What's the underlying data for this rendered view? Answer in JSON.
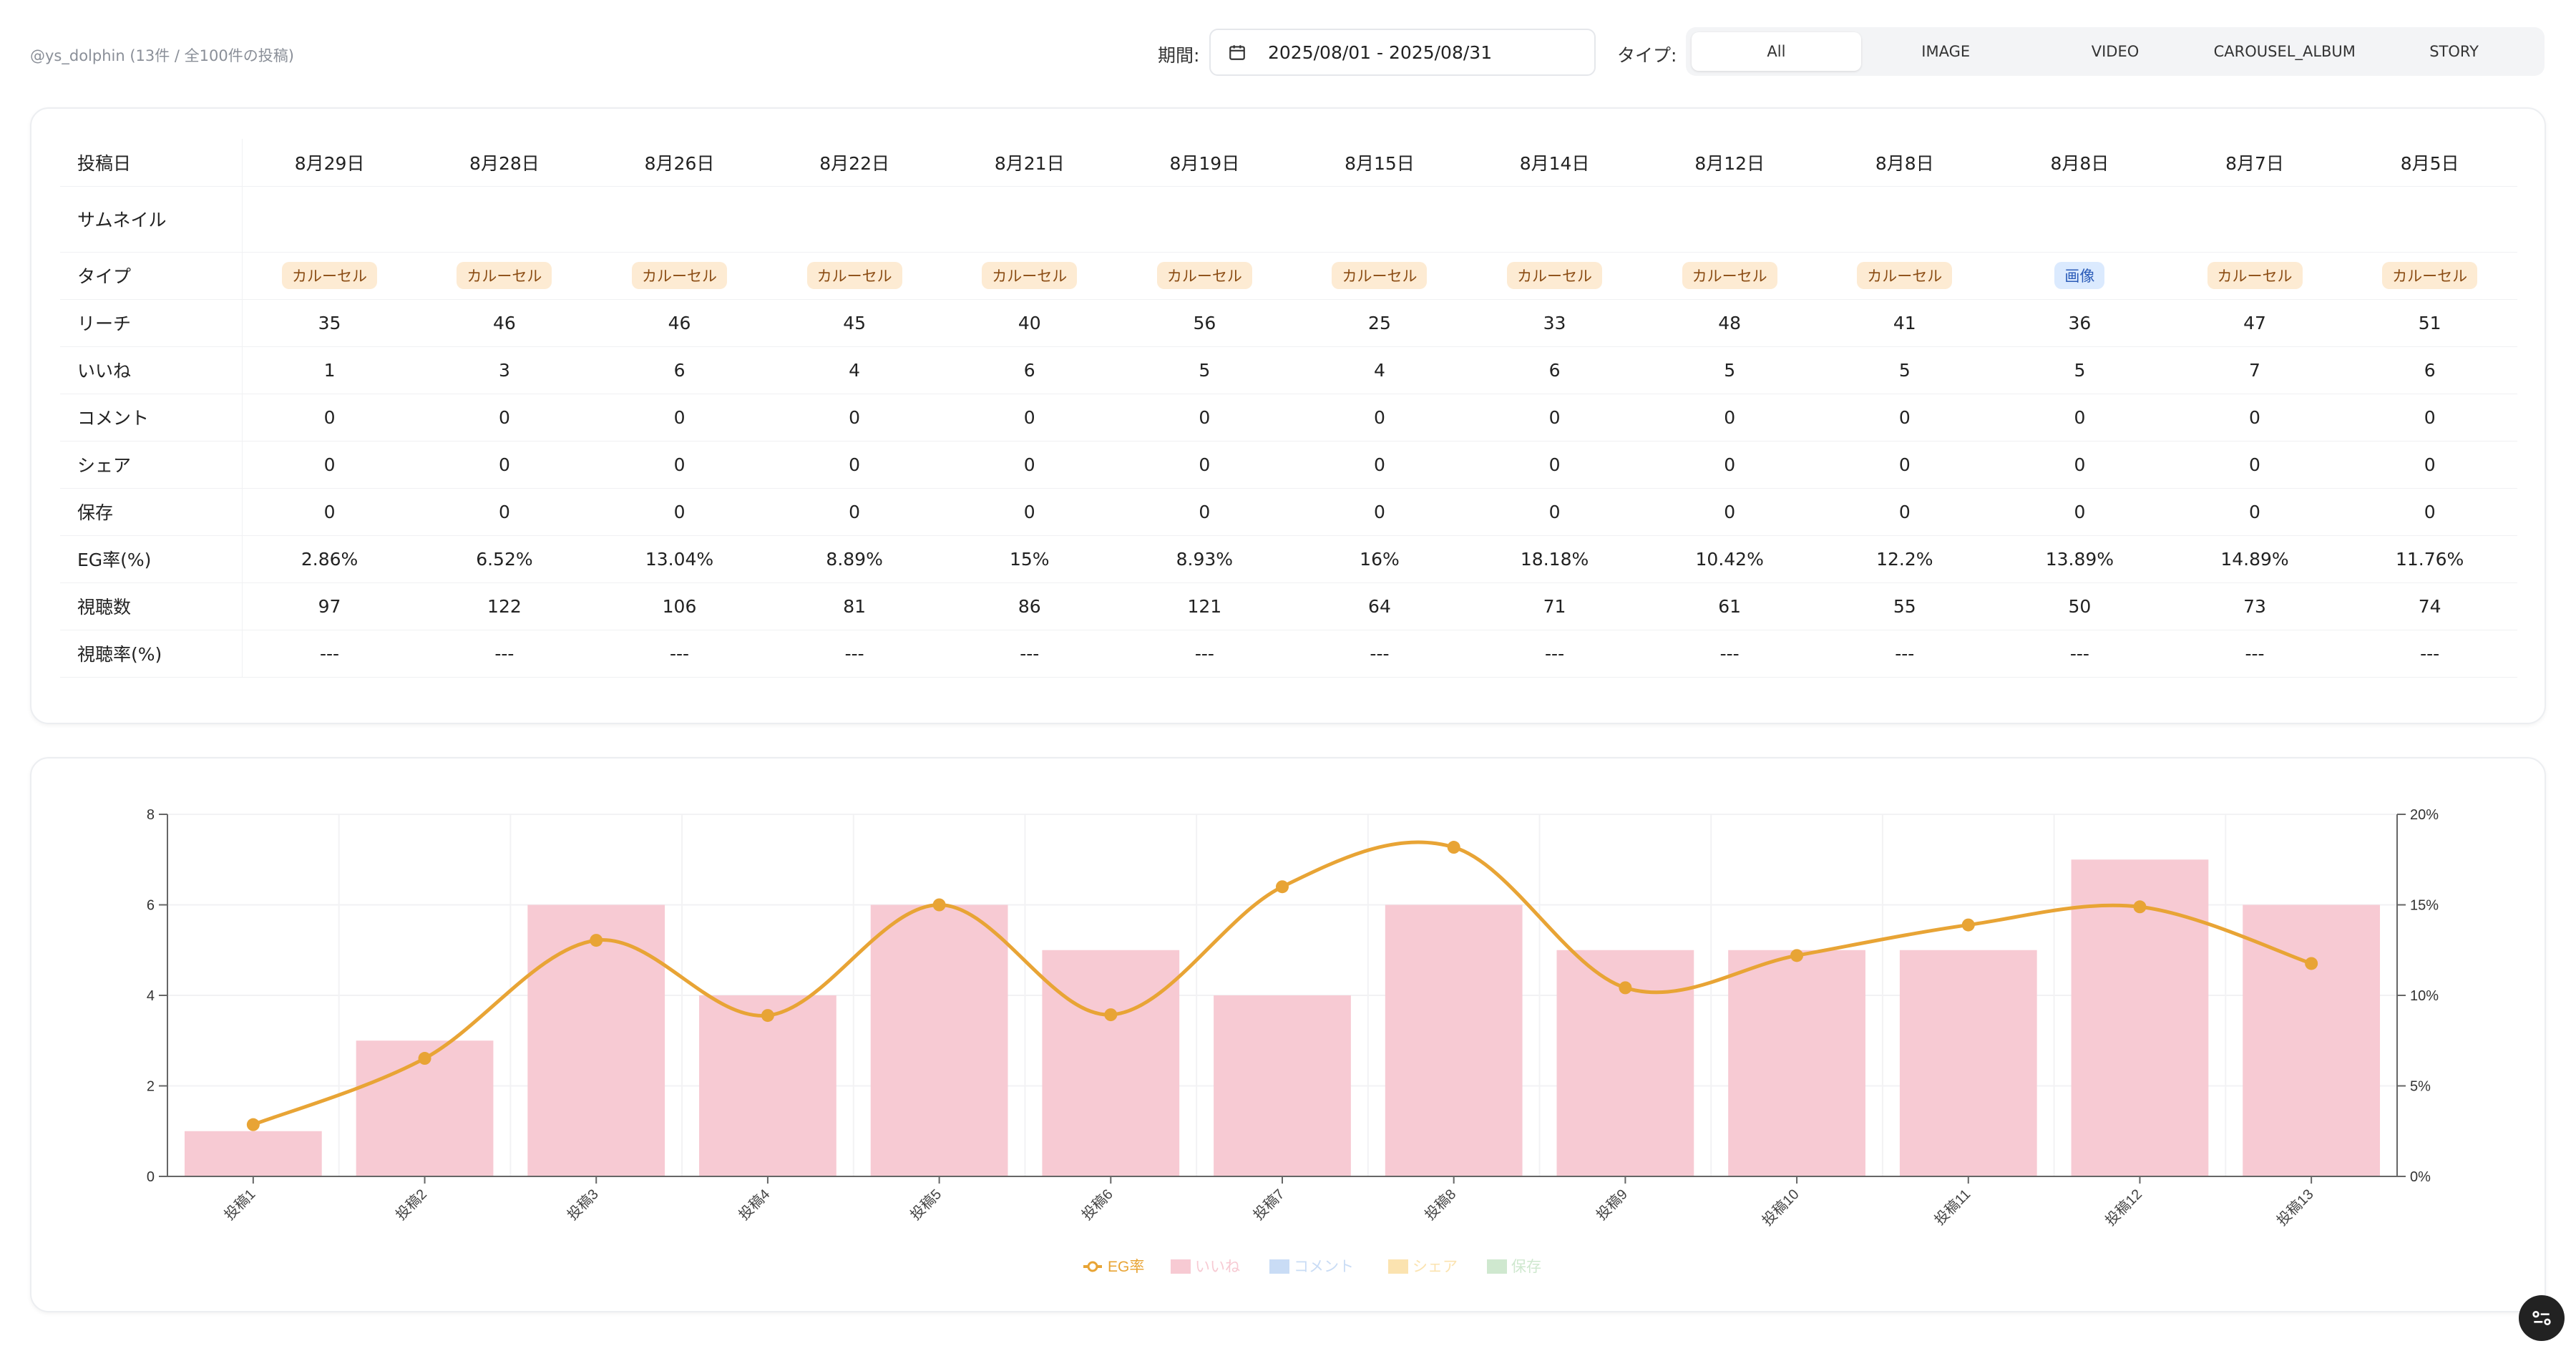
{
  "header": {
    "account": "@ys_dolphin (13件 / 全100件の投稿)",
    "period_label": "期間:",
    "date_range": "2025/08/01 - 2025/08/31",
    "type_label": "タイプ:",
    "type_options": [
      "All",
      "IMAGE",
      "VIDEO",
      "CAROUSEL_ALBUM",
      "STORY"
    ],
    "type_selected": "All"
  },
  "table": {
    "row_labels": {
      "date": "投稿日",
      "thumbnail": "サムネイル",
      "type": "タイプ",
      "reach": "リーチ",
      "likes": "いいね",
      "comments": "コメント",
      "shares": "シェア",
      "saves": "保存",
      "eg_rate": "EG率(%)",
      "views": "視聴数",
      "view_rate": "視聴率(%)"
    },
    "posts": [
      {
        "date": "8月29日",
        "type": "カルーセル",
        "type_kind": "carousel",
        "reach": "35",
        "likes": "1",
        "comments": "0",
        "shares": "0",
        "saves": "0",
        "eg": "2.86%",
        "eg_color": "red",
        "views": "97",
        "view_rate": "---"
      },
      {
        "date": "8月28日",
        "type": "カルーセル",
        "type_kind": "carousel",
        "reach": "46",
        "likes": "3",
        "comments": "0",
        "shares": "0",
        "saves": "0",
        "eg": "6.52%",
        "eg_color": "orange",
        "views": "122",
        "view_rate": "---"
      },
      {
        "date": "8月26日",
        "type": "カルーセル",
        "type_kind": "carousel",
        "reach": "46",
        "likes": "6",
        "comments": "0",
        "shares": "0",
        "saves": "0",
        "eg": "13.04%",
        "eg_color": "green",
        "views": "106",
        "view_rate": "---"
      },
      {
        "date": "8月22日",
        "type": "カルーセル",
        "type_kind": "carousel",
        "reach": "45",
        "likes": "4",
        "comments": "0",
        "shares": "0",
        "saves": "0",
        "eg": "8.89%",
        "eg_color": "green",
        "views": "81",
        "view_rate": "---"
      },
      {
        "date": "8月21日",
        "type": "カルーセル",
        "type_kind": "carousel",
        "reach": "40",
        "likes": "6",
        "comments": "0",
        "shares": "0",
        "saves": "0",
        "eg": "15%",
        "eg_color": "green",
        "views": "86",
        "view_rate": "---"
      },
      {
        "date": "8月19日",
        "type": "カルーセル",
        "type_kind": "carousel",
        "reach": "56",
        "likes": "5",
        "comments": "0",
        "shares": "0",
        "saves": "0",
        "eg": "8.93%",
        "eg_color": "green",
        "views": "121",
        "view_rate": "---"
      },
      {
        "date": "8月15日",
        "type": "カルーセル",
        "type_kind": "carousel",
        "reach": "25",
        "likes": "4",
        "comments": "0",
        "shares": "0",
        "saves": "0",
        "eg": "16%",
        "eg_color": "green",
        "views": "64",
        "view_rate": "---"
      },
      {
        "date": "8月14日",
        "type": "カルーセル",
        "type_kind": "carousel",
        "reach": "33",
        "likes": "6",
        "comments": "0",
        "shares": "0",
        "saves": "0",
        "eg": "18.18%",
        "eg_color": "green",
        "views": "71",
        "view_rate": "---"
      },
      {
        "date": "8月12日",
        "type": "カルーセル",
        "type_kind": "carousel",
        "reach": "48",
        "likes": "5",
        "comments": "0",
        "shares": "0",
        "saves": "0",
        "eg": "10.42%",
        "eg_color": "green",
        "views": "61",
        "view_rate": "---"
      },
      {
        "date": "8月8日",
        "type": "カルーセル",
        "type_kind": "carousel",
        "reach": "41",
        "likes": "5",
        "comments": "0",
        "shares": "0",
        "saves": "0",
        "eg": "12.2%",
        "eg_color": "green",
        "views": "55",
        "view_rate": "---"
      },
      {
        "date": "8月8日",
        "type": "画像",
        "type_kind": "image",
        "reach": "36",
        "likes": "5",
        "comments": "0",
        "shares": "0",
        "saves": "0",
        "eg": "13.89%",
        "eg_color": "green",
        "views": "50",
        "view_rate": "---"
      },
      {
        "date": "8月7日",
        "type": "カルーセル",
        "type_kind": "carousel",
        "reach": "47",
        "likes": "7",
        "comments": "0",
        "shares": "0",
        "saves": "0",
        "eg": "14.89%",
        "eg_color": "green",
        "views": "73",
        "view_rate": "---"
      },
      {
        "date": "8月5日",
        "type": "カルーセル",
        "type_kind": "carousel",
        "reach": "51",
        "likes": "6",
        "comments": "0",
        "shares": "0",
        "saves": "0",
        "eg": "11.76%",
        "eg_color": "green",
        "views": "74",
        "view_rate": "---"
      }
    ]
  },
  "chart_data": {
    "type": "bar",
    "categories": [
      "投稿1",
      "投稿2",
      "投稿3",
      "投稿4",
      "投稿5",
      "投稿6",
      "投稿7",
      "投稿8",
      "投稿9",
      "投稿10",
      "投稿11",
      "投稿12",
      "投稿13"
    ],
    "series": [
      {
        "name": "いいね",
        "type": "bar",
        "axis": "left",
        "color": "#f7cad3",
        "values": [
          1,
          3,
          6,
          4,
          6,
          5,
          4,
          6,
          5,
          5,
          5,
          7,
          6
        ]
      },
      {
        "name": "EG率",
        "type": "line",
        "axis": "right",
        "color": "#e8a435",
        "values": [
          2.86,
          6.52,
          13.04,
          8.89,
          15,
          8.93,
          16,
          18.18,
          10.42,
          12.2,
          13.89,
          14.89,
          11.76
        ]
      }
    ],
    "left_ticks": [
      "0",
      "2",
      "4",
      "6",
      "8"
    ],
    "right_ticks": [
      "0%",
      "5%",
      "10%",
      "15%",
      "20%"
    ],
    "ylim_left": [
      0,
      8
    ],
    "ylim_right": [
      0,
      20
    ],
    "legend": [
      {
        "name": "EG率",
        "color": "#e8a435",
        "kind": "line"
      },
      {
        "name": "いいね",
        "color": "#f7cad3",
        "kind": "box"
      },
      {
        "name": "コメント",
        "color": "#c9dcf5",
        "kind": "box"
      },
      {
        "name": "シェア",
        "color": "#fbe3b0",
        "kind": "box"
      },
      {
        "name": "保存",
        "color": "#cfe8cf",
        "kind": "box"
      }
    ],
    "legend_position": "bottom"
  }
}
